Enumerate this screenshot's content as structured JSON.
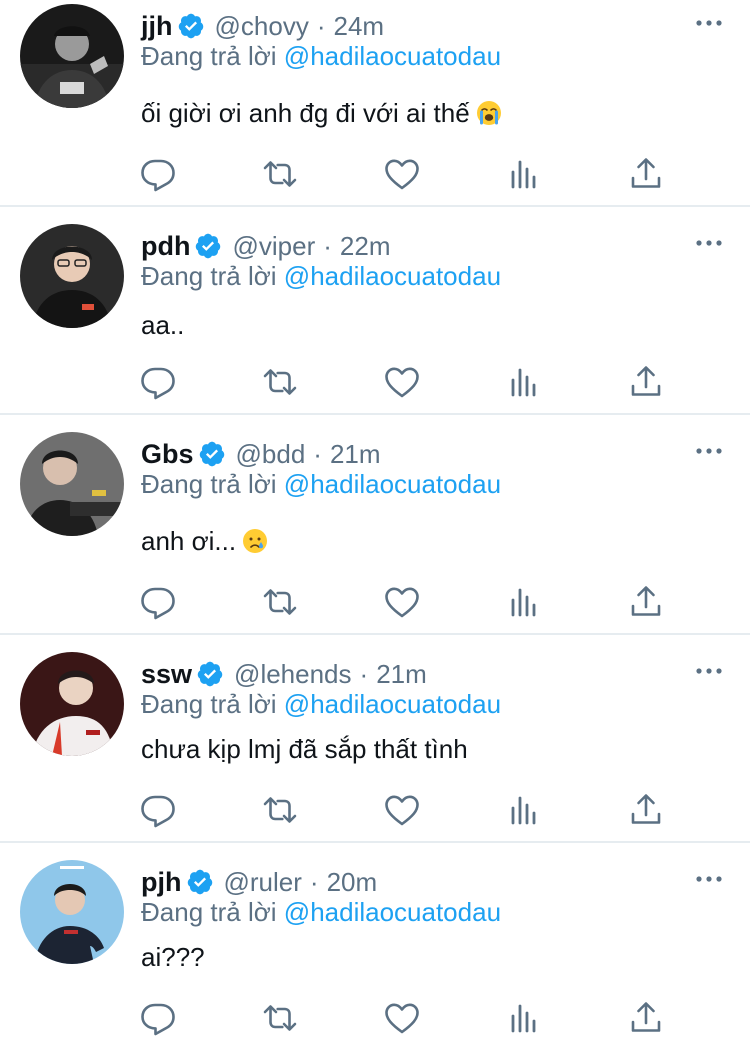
{
  "tweets": [
    {
      "name": "jjh",
      "handle": "@chovy",
      "dot": "·",
      "time": "24m",
      "reply_prefix": "Đang trả lời",
      "reply_to": "@hadilaocuatodau",
      "text": "ối giời ơi anh đg đi với ai thế",
      "emoji": "loudly-crying-face",
      "verified": true
    },
    {
      "name": "pdh",
      "handle": "@viper",
      "dot": "·",
      "time": "22m",
      "reply_prefix": "Đang trả lời",
      "reply_to": "@hadilaocuatodau",
      "text": "aa..",
      "emoji": "",
      "verified": true
    },
    {
      "name": "Gbs",
      "handle": "@bdd",
      "dot": "·",
      "time": "21m",
      "reply_prefix": "Đang trả lời",
      "reply_to": "@hadilaocuatodau",
      "text": "anh ơi...",
      "emoji": "crying-face",
      "verified": true
    },
    {
      "name": "ssw",
      "handle": "@lehends",
      "dot": "·",
      "time": "21m",
      "reply_prefix": "Đang trả lời",
      "reply_to": "@hadilaocuatodau",
      "text": "chưa kịp lmj đã sắp thất tình",
      "emoji": "",
      "verified": true
    },
    {
      "name": "pjh",
      "handle": "@ruler",
      "dot": "·",
      "time": "20m",
      "reply_prefix": "Đang trả lời",
      "reply_to": "@hadilaocuatodau",
      "text": "ai???",
      "emoji": "",
      "verified": true
    }
  ],
  "icons": {
    "reply": "reply-icon",
    "retweet": "retweet-icon",
    "like": "heart-icon",
    "stats": "analytics-icon",
    "share": "share-icon",
    "more": "more-icon",
    "verified": "verified-badge-icon"
  },
  "colors": {
    "accent": "#1da1f2",
    "secondary_text": "#5b7083",
    "primary_text": "#0f1419",
    "divider": "#e6ecf0"
  }
}
